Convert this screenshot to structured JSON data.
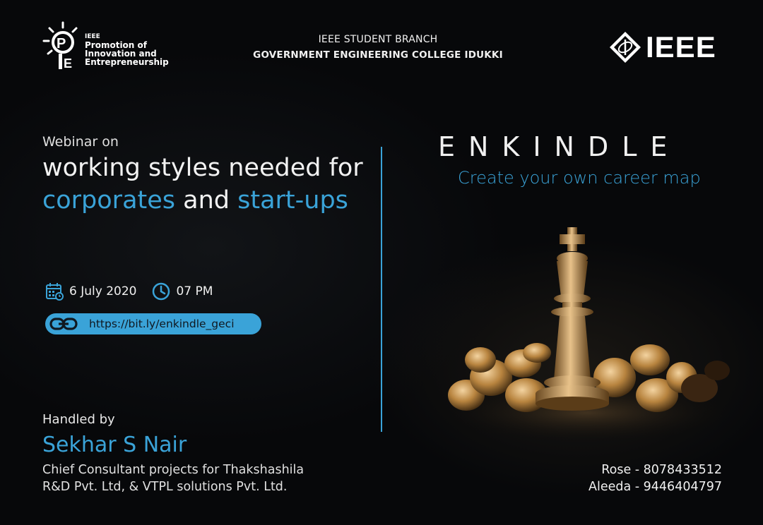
{
  "pie_logo": {
    "line1": "IEEE",
    "line2": "Promotion of",
    "line3": "Innovation and",
    "line4": "Entrepreneurship"
  },
  "header": {
    "branch_line1": "IEEE STUDENT BRANCH",
    "branch_line2": "GOVERNMENT ENGINEERING COLLEGE IDUKKI",
    "ieee_word": "IEEE"
  },
  "webinar": {
    "intro": "Webinar on",
    "title_line1": "working styles needed for",
    "title_part_a": "corporates",
    "title_part_and": " and ",
    "title_part_b": "start-ups"
  },
  "event": {
    "date": "6 July 2020",
    "time": "07 PM",
    "link": "https://bit.ly/enkindle_geci"
  },
  "speaker": {
    "handled_by": "Handled by",
    "name": "Sekhar S Nair",
    "role_line1": "Chief Consultant projects for Thakshashila",
    "role_line2": "R&D Pvt.  Ltd, & VTPL solutions Pvt. Ltd."
  },
  "brand": {
    "name": "ENKINDLE",
    "tagline": "Create your own career map"
  },
  "contacts": [
    "Rose - 8078433512",
    "Aleeda - 9446404797"
  ],
  "icons": {
    "calendar": "calendar-icon",
    "clock": "clock-icon",
    "link": "link-icon"
  },
  "colors": {
    "background": "#07080a",
    "accent": "#3aa3d8",
    "gold": "#c99a55"
  }
}
